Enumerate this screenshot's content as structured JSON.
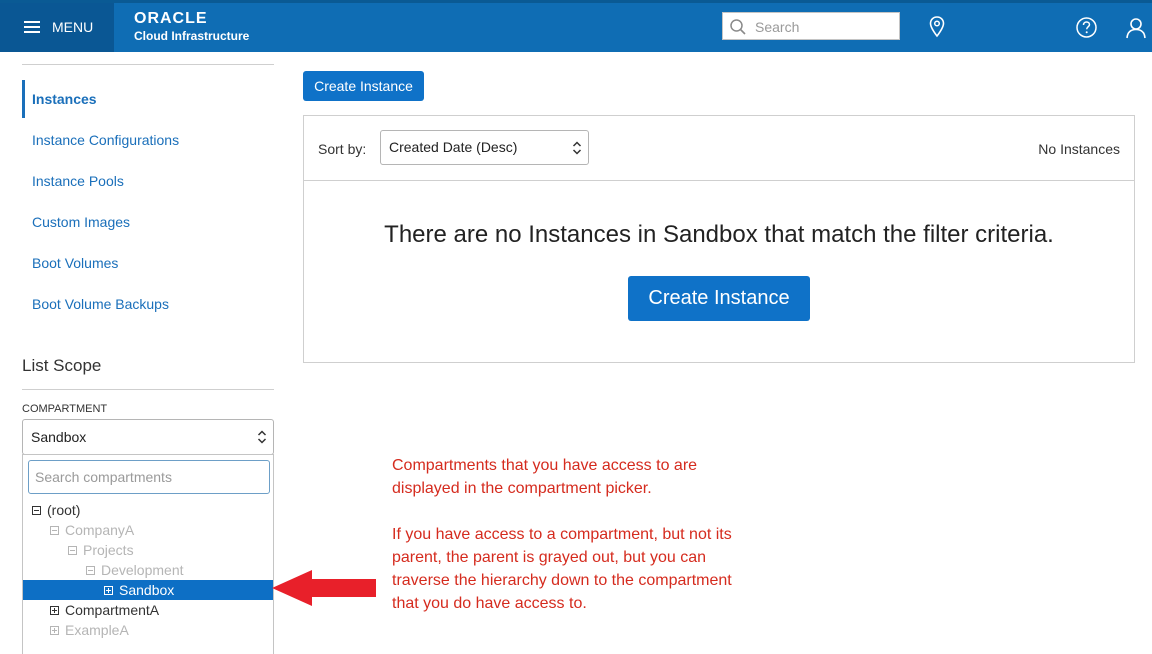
{
  "header": {
    "menu_label": "MENU",
    "brand_name": "ORACLE",
    "brand_sub": "Cloud Infrastructure",
    "search_placeholder": "Search",
    "icons": [
      "hamburger-icon",
      "search-icon",
      "location-pin-icon",
      "help-icon",
      "user-icon"
    ]
  },
  "sidebar": {
    "nav": [
      {
        "label": "Instances",
        "active": true
      },
      {
        "label": "Instance Configurations"
      },
      {
        "label": "Instance Pools"
      },
      {
        "label": "Custom Images"
      },
      {
        "label": "Boot Volumes"
      },
      {
        "label": "Boot Volume Backups"
      }
    ],
    "scope_title": "List Scope",
    "compartment_label": "COMPARTMENT",
    "compartment_value": "Sandbox",
    "compartment_search_placeholder": "Search compartments",
    "tree": [
      {
        "label": "(root)",
        "state": "expanded",
        "access": true
      },
      {
        "label": "CompanyA",
        "state": "expanded",
        "access": false
      },
      {
        "label": "Projects",
        "state": "expanded",
        "access": false
      },
      {
        "label": "Development",
        "state": "expanded",
        "access": false
      },
      {
        "label": "Sandbox",
        "state": "collapsed",
        "access": true,
        "selected": true
      },
      {
        "label": "CompartmentA",
        "state": "collapsed",
        "access": true
      },
      {
        "label": "ExampleA",
        "state": "collapsed",
        "access": false
      }
    ]
  },
  "main": {
    "create_button": "Create Instance",
    "sort_label": "Sort by:",
    "sort_value": "Created Date (Desc)",
    "count_label": "No Instances",
    "empty_message": "There are no Instances in Sandbox that match the filter criteria.",
    "empty_create_button": "Create Instance"
  },
  "annotation": {
    "line1": "Compartments that you have access to are displayed in the compartment picker.",
    "line2": "If you have access to a compartment, but not its parent, the parent is grayed out, but you can traverse the hierarchy down to the compartment that you do have access to."
  },
  "colors": {
    "header": "#0f6db4",
    "menu": "#0a5794",
    "accent": "#0f72c8",
    "link": "#1a6fba",
    "annotation": "#d52b1e",
    "arrow": "#e8202a"
  }
}
